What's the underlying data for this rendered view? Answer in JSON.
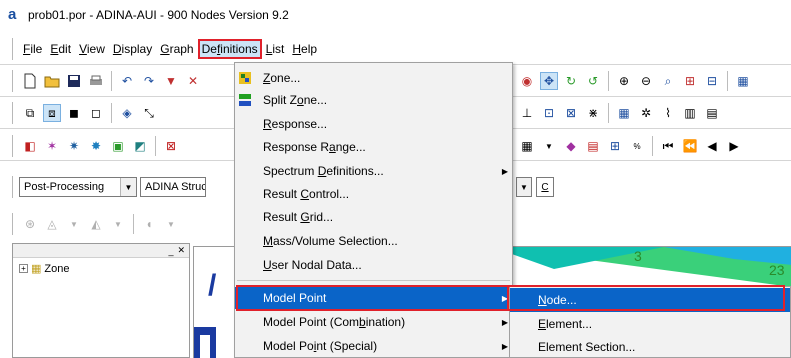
{
  "window": {
    "title": "prob01.por - ADINA-AUI - 900 Nodes Version 9.2",
    "app_icon": "a"
  },
  "menubar": {
    "items": [
      {
        "label": "File",
        "ul": "F"
      },
      {
        "label": "Edit",
        "ul": "E"
      },
      {
        "label": "View",
        "ul": "V"
      },
      {
        "label": "Display",
        "ul": "D"
      },
      {
        "label": "Graph",
        "ul": "G"
      },
      {
        "label": "Definitions",
        "ul": "f"
      },
      {
        "label": "List",
        "ul": "L"
      },
      {
        "label": "Help",
        "ul": "H"
      }
    ]
  },
  "combos": {
    "mode": "Post-Processing",
    "program": "ADINA Structu",
    "right_button": "C"
  },
  "tree": {
    "root_label": "Zone",
    "expander": "+"
  },
  "viewport": {
    "labels": [
      "3",
      "23"
    ]
  },
  "definitions_menu": {
    "items": [
      {
        "label": "Zone...",
        "ul_index": 0,
        "icon": "zone-icon"
      },
      {
        "label": "Split Zone...",
        "ul_index": 6,
        "icon": "split-zone-icon"
      },
      {
        "label": "Response...",
        "ul_index": 0
      },
      {
        "label": "Response Range...",
        "ul_index": 9
      },
      {
        "label": "Spectrum Definitions...",
        "ul_index": 9,
        "submenu": true
      },
      {
        "label": "Result Control...",
        "ul_index": 7
      },
      {
        "label": "Result Grid...",
        "ul_index": 7
      },
      {
        "label": "Mass/Volume Selection...",
        "ul_index": 0
      },
      {
        "label": "User Nodal Data...",
        "ul_index": 0
      },
      {
        "label": "Model Point",
        "submenu": true,
        "highlighted": true
      },
      {
        "label": "Model Point (Combination)",
        "ul_index": 16,
        "submenu": true
      },
      {
        "label": "Model Point (Special)",
        "ul_index": 15,
        "submenu": true
      }
    ]
  },
  "model_point_submenu": {
    "items": [
      {
        "label": "Node...",
        "ul": "N",
        "highlighted": true
      },
      {
        "label": "Element...",
        "ul": "E"
      },
      {
        "label": "Element Section...",
        "ul": ""
      }
    ]
  },
  "colors": {
    "highlight": "#0a64c8",
    "callout": "#e0212b",
    "menu_bg": "#f2f2f2"
  }
}
